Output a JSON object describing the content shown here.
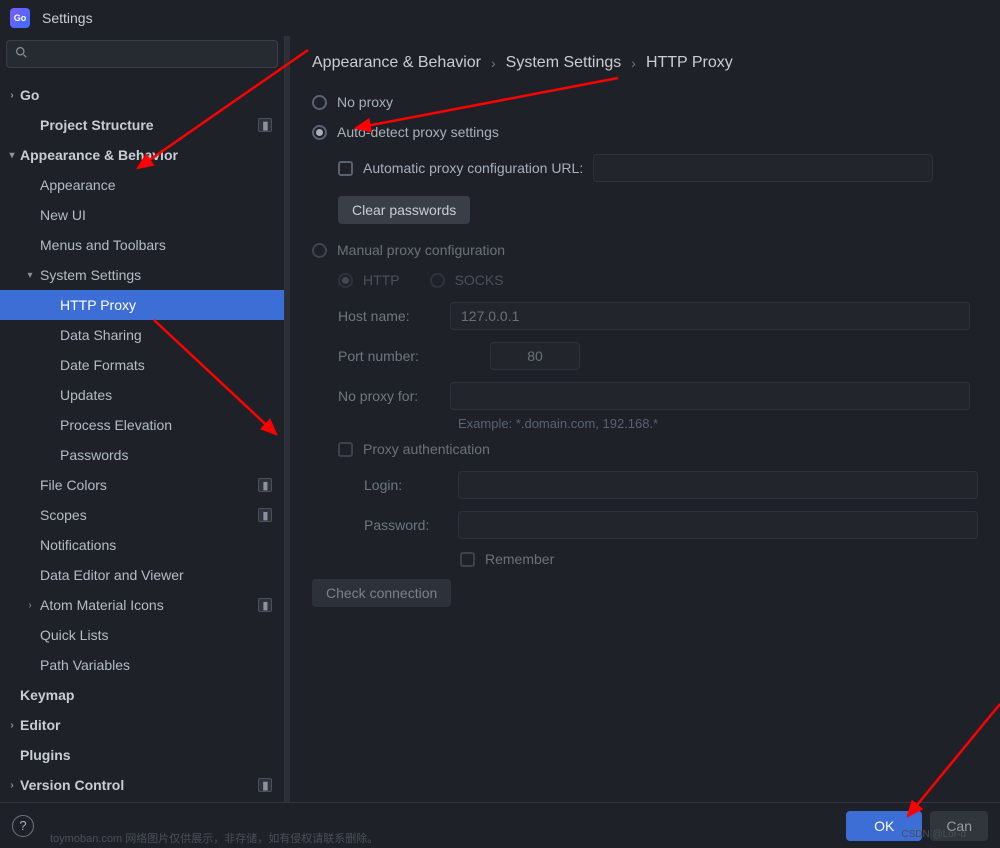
{
  "title": "Settings",
  "breadcrumb": [
    "Appearance & Behavior",
    "System Settings",
    "HTTP Proxy"
  ],
  "sidebar": {
    "items": [
      {
        "label": "Go",
        "kind": "chev",
        "state": "collapsed",
        "indent": 0,
        "bold": true,
        "sepIcon": false
      },
      {
        "label": "Project Structure",
        "kind": "plain",
        "indent": 1,
        "bold": true,
        "sepIcon": true
      },
      {
        "label": "Appearance & Behavior",
        "kind": "chev",
        "state": "expanded",
        "indent": 0,
        "bold": true,
        "sepIcon": false
      },
      {
        "label": "Appearance",
        "kind": "plain",
        "indent": 1,
        "bold": false,
        "sepIcon": false
      },
      {
        "label": "New UI",
        "kind": "plain",
        "indent": 1,
        "bold": false,
        "sepIcon": false
      },
      {
        "label": "Menus and Toolbars",
        "kind": "plain",
        "indent": 1,
        "bold": false,
        "sepIcon": false
      },
      {
        "label": "System Settings",
        "kind": "chev",
        "state": "expanded",
        "indent": 1,
        "bold": false,
        "sepIcon": false
      },
      {
        "label": "HTTP Proxy",
        "kind": "plain",
        "indent": 2,
        "bold": false,
        "sepIcon": false,
        "selected": true
      },
      {
        "label": "Data Sharing",
        "kind": "plain",
        "indent": 2,
        "bold": false,
        "sepIcon": false
      },
      {
        "label": "Date Formats",
        "kind": "plain",
        "indent": 2,
        "bold": false,
        "sepIcon": false
      },
      {
        "label": "Updates",
        "kind": "plain",
        "indent": 2,
        "bold": false,
        "sepIcon": false
      },
      {
        "label": "Process Elevation",
        "kind": "plain",
        "indent": 2,
        "bold": false,
        "sepIcon": false
      },
      {
        "label": "Passwords",
        "kind": "plain",
        "indent": 2,
        "bold": false,
        "sepIcon": false
      },
      {
        "label": "File Colors",
        "kind": "plain",
        "indent": 1,
        "bold": false,
        "sepIcon": true
      },
      {
        "label": "Scopes",
        "kind": "plain",
        "indent": 1,
        "bold": false,
        "sepIcon": true
      },
      {
        "label": "Notifications",
        "kind": "plain",
        "indent": 1,
        "bold": false,
        "sepIcon": false
      },
      {
        "label": "Data Editor and Viewer",
        "kind": "plain",
        "indent": 1,
        "bold": false,
        "sepIcon": false
      },
      {
        "label": "Atom Material Icons",
        "kind": "chev",
        "state": "collapsed",
        "indent": 1,
        "bold": false,
        "sepIcon": true
      },
      {
        "label": "Quick Lists",
        "kind": "plain",
        "indent": 1,
        "bold": false,
        "sepIcon": false
      },
      {
        "label": "Path Variables",
        "kind": "plain",
        "indent": 1,
        "bold": false,
        "sepIcon": false
      },
      {
        "label": "Keymap",
        "kind": "plain",
        "indent": 0,
        "bold": true,
        "sepIcon": false,
        "noChev": true
      },
      {
        "label": "Editor",
        "kind": "chev",
        "state": "collapsed",
        "indent": 0,
        "bold": true,
        "sepIcon": false
      },
      {
        "label": "Plugins",
        "kind": "plain",
        "indent": 0,
        "bold": true,
        "sepIcon": false,
        "noChev": true
      },
      {
        "label": "Version Control",
        "kind": "chev",
        "state": "collapsed",
        "indent": 0,
        "bold": true,
        "sepIcon": true
      }
    ]
  },
  "proxy": {
    "no_proxy_label": "No proxy",
    "auto_detect_label": "Auto-detect proxy settings",
    "auto_url_label": "Automatic proxy configuration URL:",
    "clear_passwords": "Clear passwords",
    "manual_label": "Manual proxy configuration",
    "http_label": "HTTP",
    "socks_label": "SOCKS",
    "host_label": "Host name:",
    "host_value": "127.0.0.1",
    "port_label": "Port number:",
    "port_value": "80",
    "noproxyfor_label": "No proxy for:",
    "example_text": "Example: *.domain.com, 192.168.*",
    "auth_label": "Proxy authentication",
    "login_label": "Login:",
    "password_label": "Password:",
    "remember_label": "Remember",
    "check_connection": "Check connection"
  },
  "footer": {
    "ok": "OK",
    "cancel": "Can"
  },
  "watermark": "toymoban.com 网络图片仅供展示，非存储，如有侵权请联系删除。",
  "watermark2": "CSDN @Lor-d"
}
